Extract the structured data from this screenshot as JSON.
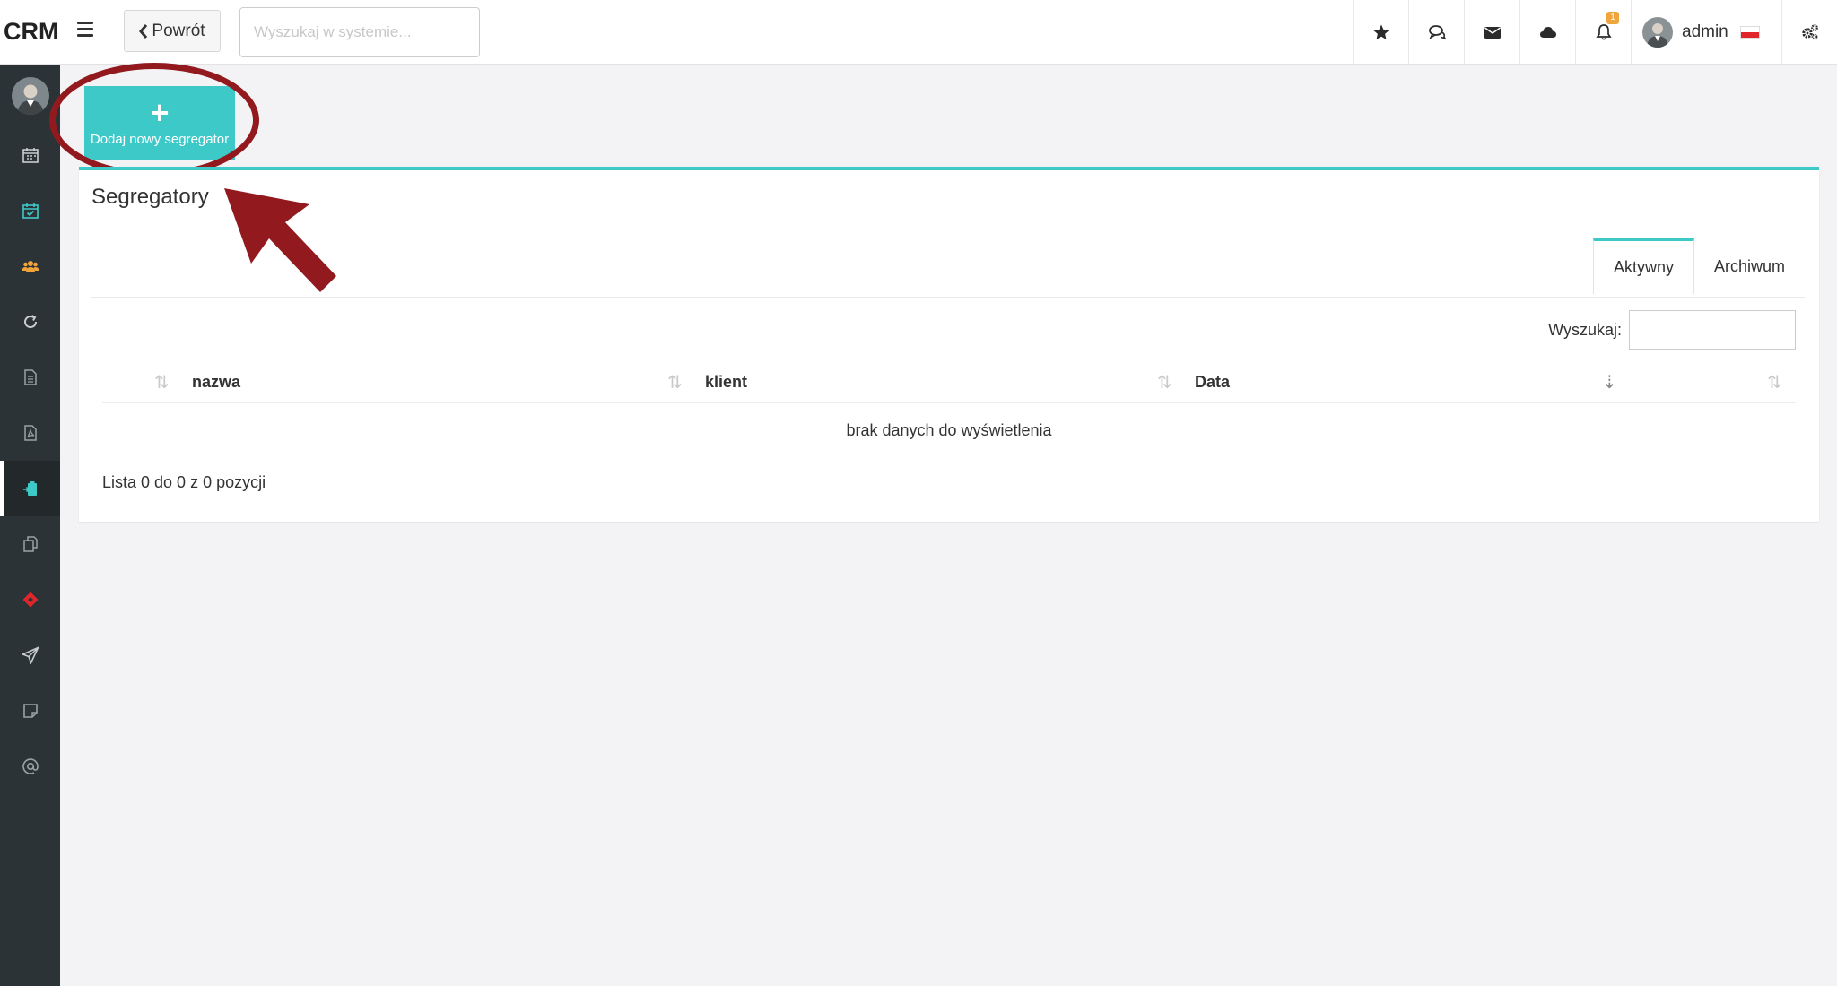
{
  "app": {
    "logo": "CRM"
  },
  "header": {
    "back_label": "Powrót",
    "search_placeholder": "Wyszukaj w systemie...",
    "notifications_count": "1",
    "user_name": "admin"
  },
  "main": {
    "add_button_label": "Dodaj nowy segregator",
    "panel_title": "Segregatory",
    "tabs": [
      {
        "label": "Aktywny"
      },
      {
        "label": "Archiwum"
      }
    ],
    "search_label": "Wyszukaj:",
    "columns": [
      {
        "label": "nazwa"
      },
      {
        "label": "klient"
      },
      {
        "label": "Data"
      }
    ],
    "empty_text": "brak danych do wyświetlenia",
    "info_text": "Lista 0 do 0 z 0 pozycji"
  },
  "colors": {
    "accent": "#3ec9c9",
    "sidebar": "#2b3336",
    "annotation": "#921a1e",
    "badge": "#f0a43c"
  }
}
